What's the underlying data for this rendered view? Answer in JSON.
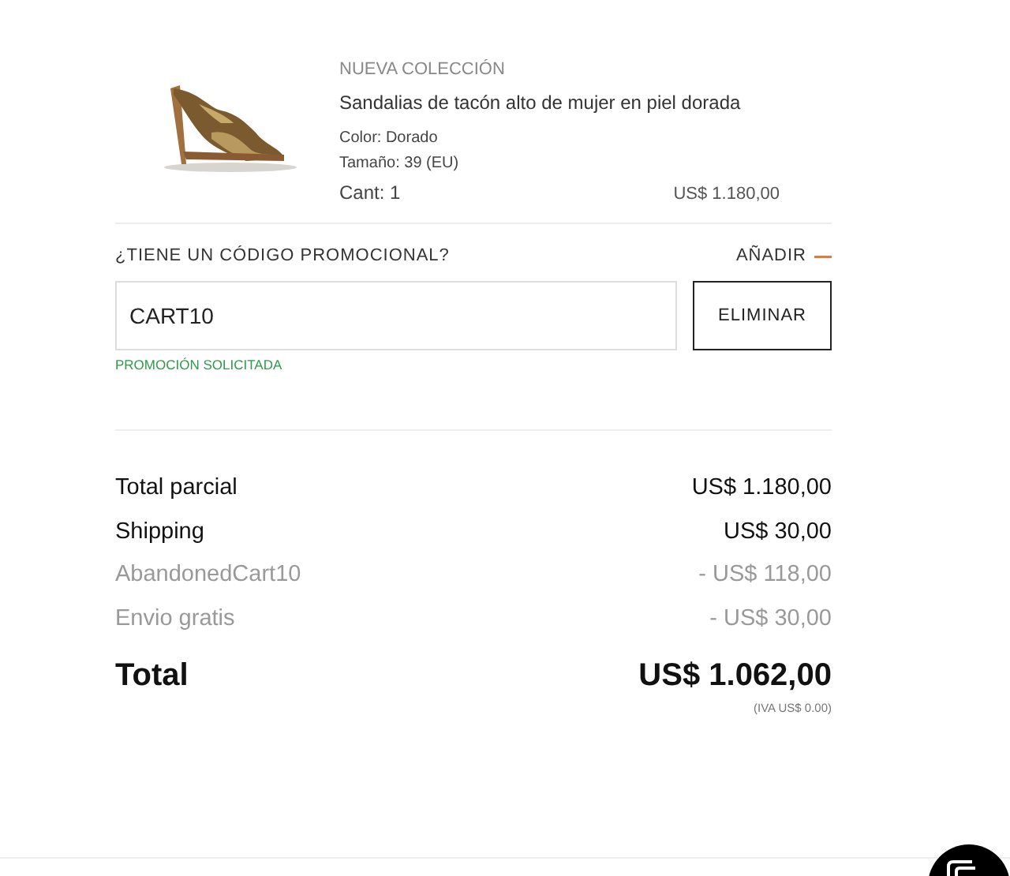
{
  "product": {
    "collection": "NUEVA COLECCIÓN",
    "name": "Sandalias de tacón alto de mujer en piel dorada",
    "attributes": [
      "Color: Dorado",
      "Tamaño: 39 (EU)"
    ],
    "quantity": "Cant: 1",
    "price": "US$ 1.180,00"
  },
  "promo": {
    "question": "¿TIENE UN CÓDIGO PROMOCIONAL?",
    "toggle": "AÑADIR",
    "expanded": true,
    "code": "CART10",
    "button": "ELIMINAR",
    "status": "PROMOCIÓN SOLICITADA"
  },
  "summary": [
    {
      "kind": "regular",
      "label": "Total parcial",
      "amount": "US$ 1.180,00"
    },
    {
      "kind": "regular",
      "label": "Shipping",
      "amount": "US$ 30,00"
    },
    {
      "kind": "discount",
      "label": "AbandonedCart10",
      "amount": "- US$ 118,00"
    },
    {
      "kind": "discount",
      "label": "Envio gratis",
      "amount": "- US$ 30,00"
    }
  ],
  "total": {
    "label": "Total",
    "amount": "US$ 1.062,00",
    "tax": "(IVA US$ 0.00)"
  }
}
